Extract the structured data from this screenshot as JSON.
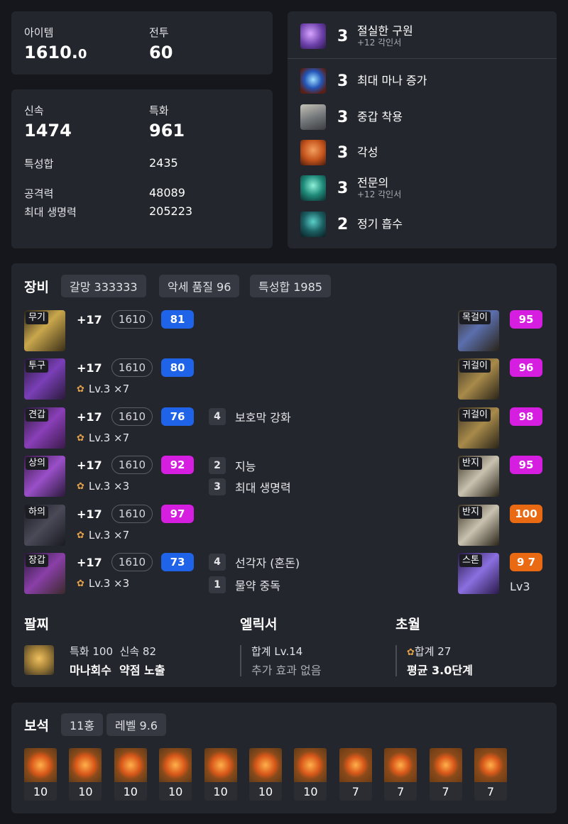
{
  "stats": {
    "item_label": "아이템",
    "item_value_main": "1610.",
    "item_value_frac": "0",
    "combat_label": "전투",
    "combat_value": "60",
    "swift_label": "신속",
    "swift_value": "1474",
    "spec_label": "특화",
    "spec_value": "961",
    "total_label": "특성합",
    "total_value": "2435",
    "atk_label": "공격력",
    "atk_value": "48089",
    "hp_label": "최대 생명력",
    "hp_value": "205223"
  },
  "engravings": [
    {
      "level": "3",
      "name": "절실한 구원",
      "sub": "+12 각인서",
      "icon": "hammer-icon",
      "color": "#6a3fa8"
    },
    {
      "level": "3",
      "name": "최대 마나 증가",
      "sub": "",
      "icon": "mana-orb-icon",
      "color": "#2355b8"
    },
    {
      "level": "3",
      "name": "중갑 착용",
      "sub": "",
      "icon": "heavy-armor-icon",
      "color": "#777a7d"
    },
    {
      "level": "3",
      "name": "각성",
      "sub": "",
      "icon": "awakening-icon",
      "color": "#c7561e"
    },
    {
      "level": "3",
      "name": "전문의",
      "sub": "+12 각인서",
      "icon": "specialist-icon",
      "color": "#1f8a7a"
    },
    {
      "level": "2",
      "name": "정기 흡수",
      "sub": "",
      "icon": "spirit-absorb-icon",
      "color": "#1c5f63"
    }
  ],
  "equipment": {
    "title": "장비",
    "tags": [
      "갈망 333333",
      "악세 품질 96",
      "특성합 1985"
    ],
    "gear": [
      {
        "type": "무기",
        "plus": "+17",
        "ilvl": "1610",
        "quality": "81",
        "qcolor": "blue",
        "elixir": "",
        "icon": "weapon-icon"
      },
      {
        "type": "투구",
        "plus": "+17",
        "ilvl": "1610",
        "quality": "80",
        "qcolor": "blue",
        "elixir": "Lv.3  ×7",
        "icon": "helmet-icon"
      },
      {
        "type": "견갑",
        "plus": "+17",
        "ilvl": "1610",
        "quality": "76",
        "qcolor": "blue",
        "elixir": "Lv.3  ×7",
        "icon": "shoulder-icon"
      },
      {
        "type": "상의",
        "plus": "+17",
        "ilvl": "1610",
        "quality": "92",
        "qcolor": "pink",
        "elixir": "Lv.3  ×3",
        "icon": "chest-icon"
      },
      {
        "type": "하의",
        "plus": "+17",
        "ilvl": "1610",
        "quality": "97",
        "qcolor": "pink",
        "elixir": "Lv.3  ×7",
        "icon": "pants-icon"
      },
      {
        "type": "장갑",
        "plus": "+17",
        "ilvl": "1610",
        "quality": "73",
        "qcolor": "blue",
        "elixir": "Lv.3  ×3",
        "icon": "gloves-icon"
      }
    ],
    "effects": [
      {
        "n": "4",
        "label": "보호막 강화"
      },
      {
        "n": "2",
        "label": "지능"
      },
      {
        "n": "3",
        "label": "최대 생명력"
      },
      {
        "n": "4",
        "label": "선각자 (혼돈)"
      },
      {
        "n": "1",
        "label": "물약 중독"
      }
    ],
    "accessories": [
      {
        "type": "목걸이",
        "quality": "95",
        "qcolor": "pink",
        "icon": "necklace-icon"
      },
      {
        "type": "귀걸이",
        "quality": "96",
        "qcolor": "pink",
        "icon": "earring-icon"
      },
      {
        "type": "귀걸이",
        "quality": "98",
        "qcolor": "pink",
        "icon": "earring-icon"
      },
      {
        "type": "반지",
        "quality": "95",
        "qcolor": "pink",
        "icon": "ring-icon"
      },
      {
        "type": "반지",
        "quality": "100",
        "qcolor": "orange",
        "icon": "ring-icon"
      },
      {
        "type": "스톤",
        "quality": "9 7",
        "qcolor": "orange",
        "icon": "stone-icon",
        "sub": "Lv3"
      }
    ],
    "bracelet": {
      "title": "팔찌",
      "line1a": "특화 100",
      "line1b": "신속 82",
      "line2a": "마나회수",
      "line2b": "약점 노출"
    },
    "elixir": {
      "title": "엘릭서",
      "line1": "합계 Lv.14",
      "line2": "추가 효과 없음"
    },
    "transcend": {
      "title": "초월",
      "line1": "합계 27",
      "line2": "평균 3.0단계"
    }
  },
  "gems": {
    "title": "보석",
    "tags": [
      "11홍",
      "레벨 9.6"
    ],
    "levels": [
      "10",
      "10",
      "10",
      "10",
      "10",
      "10",
      "10",
      "7",
      "7",
      "7",
      "7"
    ]
  }
}
